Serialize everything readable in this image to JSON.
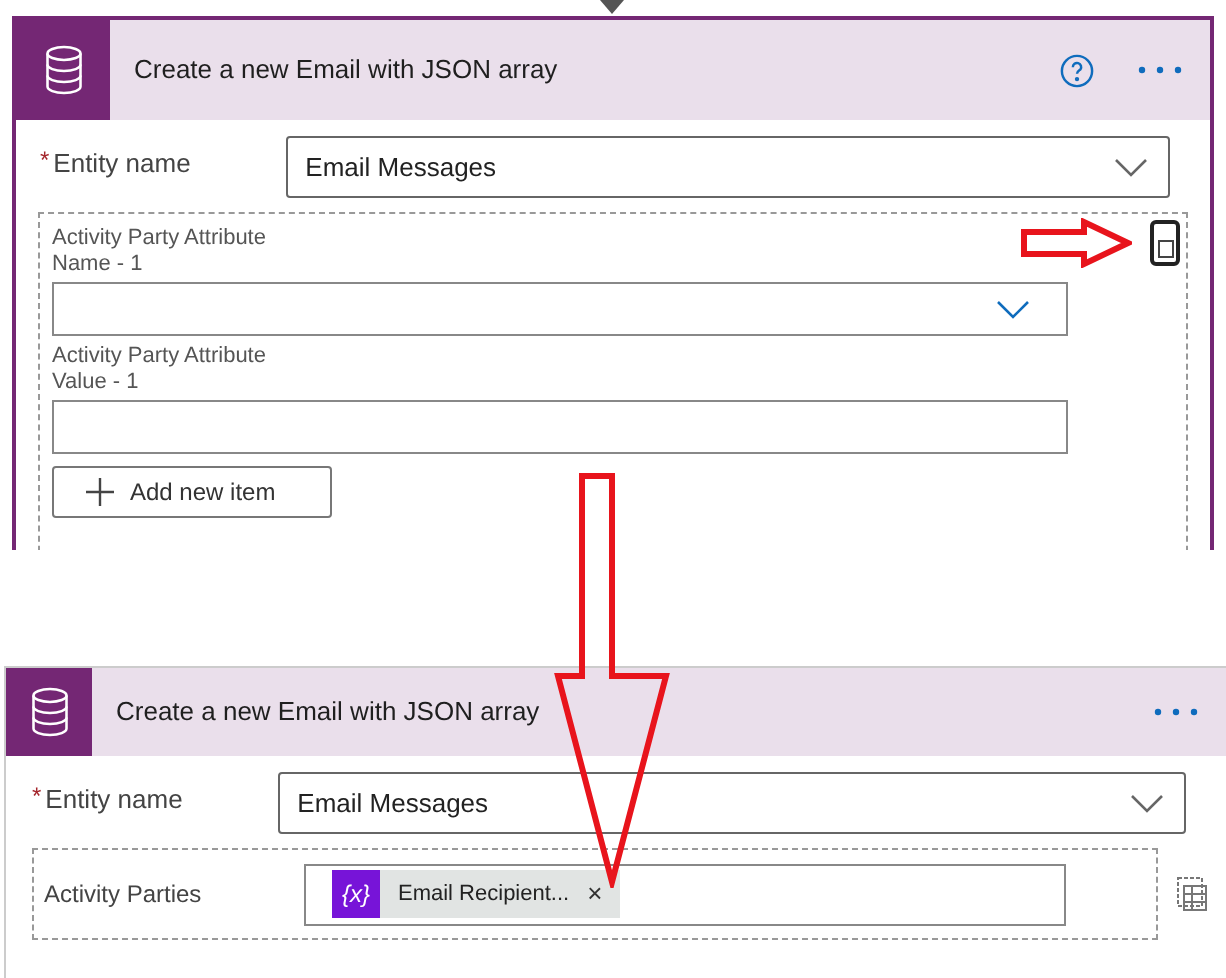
{
  "before": {
    "title": "Create a new Email with JSON array",
    "help": true,
    "entity": {
      "required": "*",
      "label": "Entity name",
      "value": "Email Messages"
    },
    "items": [
      {
        "kind": "dropdown",
        "label": "Activity Party Attribute Name - 1"
      },
      {
        "kind": "text",
        "label": "Activity Party Attribute Value - 1"
      }
    ],
    "add_button": "Add new item"
  },
  "after": {
    "title": "Create a new Email with JSON array",
    "help": false,
    "entity": {
      "required": "*",
      "label": "Entity name",
      "value": "Email Messages"
    },
    "parties": {
      "label": "Activity Parties",
      "token": {
        "icon_text": "{x}",
        "text": "Email Recipient...",
        "remove": "×"
      }
    }
  }
}
